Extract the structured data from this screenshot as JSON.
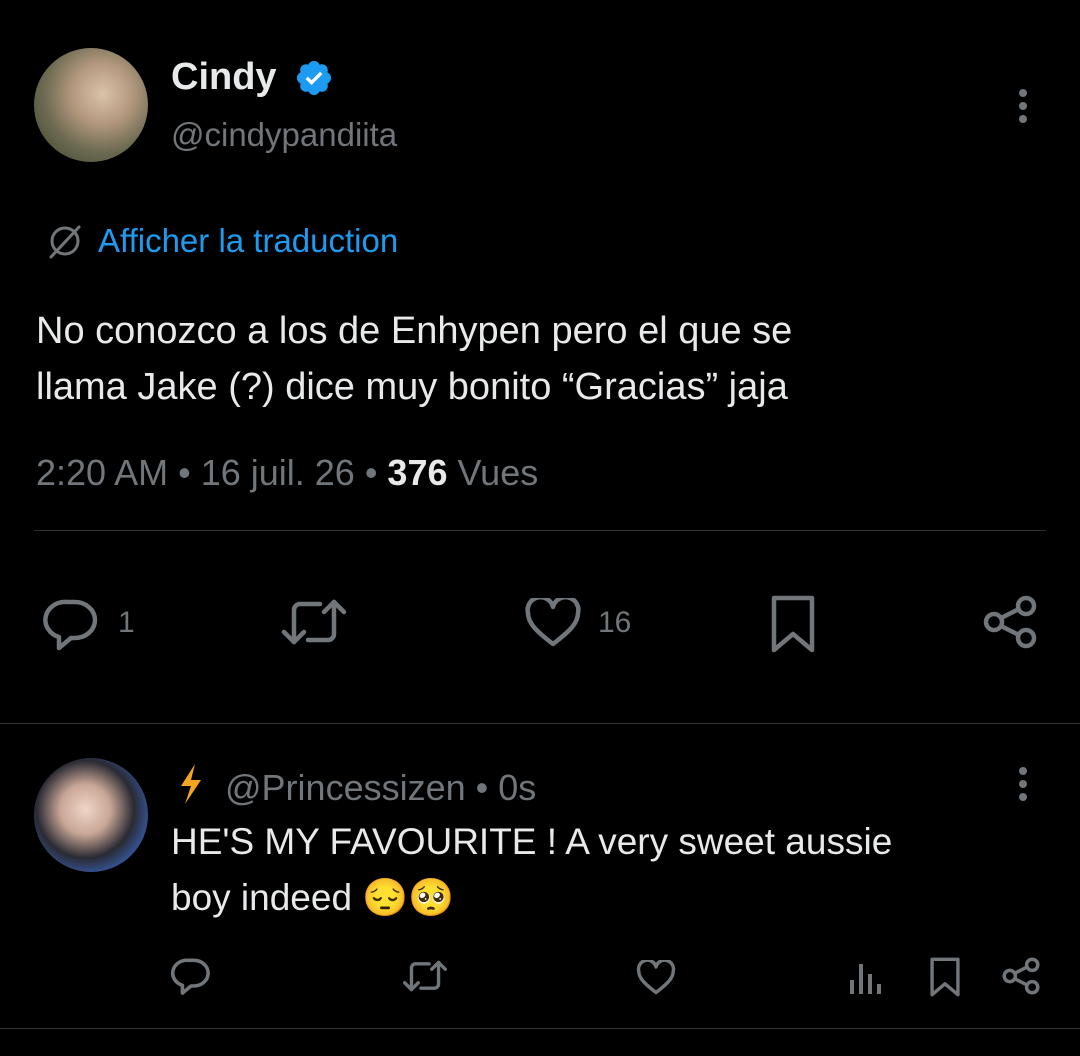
{
  "tweet": {
    "author_name": "Cindy",
    "author_handle": "@cindypandiita",
    "translate_label": "Afficher la traduction",
    "text_line1": "No conozco a los de Enhypen pero el que se",
    "text_line2": "llama Jake (?) dice muy bonito “Gracias” jaja",
    "time": "2:20 AM",
    "separator": " • ",
    "date": "16 juil. 26",
    "views_count": "376",
    "views_label": " Vues",
    "reply_count": "1",
    "like_count": "16"
  },
  "reply": {
    "prefix_icon": "lightning-icon",
    "handle": "@Princessizen",
    "separator": " • ",
    "time": "0s",
    "text_line1": "HE'S MY FAVOURITE ! A very sweet aussie",
    "text_line2": "boy indeed 😔🥺"
  },
  "icons": {
    "verified": "verified-badge-icon",
    "more": "more-vertical-icon",
    "translate": "globe-icon",
    "reply": "reply-bubble-icon",
    "retweet": "retweet-icon",
    "like": "heart-icon",
    "bookmark": "bookmark-icon",
    "share": "share-icon",
    "analytics": "analytics-icon"
  },
  "colors": {
    "background": "#000000",
    "text": "#e7e9ea",
    "secondary": "#71767b",
    "accent": "#1d9bf0",
    "divider": "#2f3336"
  }
}
